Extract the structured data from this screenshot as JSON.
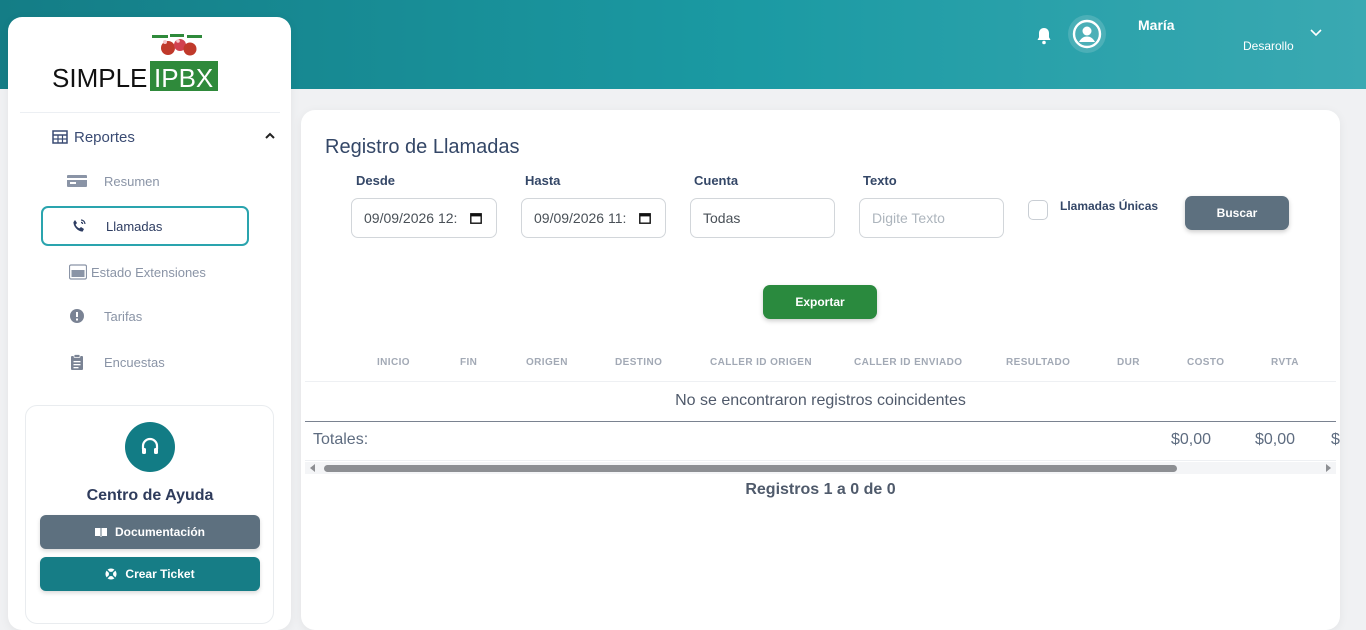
{
  "header": {
    "user_name": "María",
    "user_role": "Desarollo"
  },
  "logo": {
    "text_left": "SIMPLE",
    "text_right": "IPBX"
  },
  "sidebar": {
    "section_label": "Reportes",
    "items": [
      {
        "label": "Resumen",
        "icon": "card-icon"
      },
      {
        "label": "Llamadas",
        "icon": "phone-call-icon"
      },
      {
        "label": "Estado Extensiones",
        "icon": "monitor-icon"
      },
      {
        "label": "Tarifas",
        "icon": "alert-circle-icon"
      },
      {
        "label": "Encuestas",
        "icon": "clipboard-icon"
      }
    ]
  },
  "help": {
    "title": "Centro de Ayuda",
    "doc_label": "Documentación",
    "ticket_label": "Crear Ticket"
  },
  "main": {
    "title": "Registro de Llamadas",
    "filters": {
      "desde_label": "Desde",
      "desde_value": "09/09/2026 12:",
      "hasta_label": "Hasta",
      "hasta_value": "09/09/2026 11:",
      "cuenta_label": "Cuenta",
      "cuenta_value": "Todas",
      "texto_label": "Texto",
      "texto_placeholder": "Digite Texto",
      "unique_label": "Llamadas Únicas",
      "search_label": "Buscar"
    },
    "export_label": "Exportar",
    "table": {
      "columns": [
        "INICIO",
        "FIN",
        "ORIGEN",
        "DESTINO",
        "CALLER ID ORIGEN",
        "CALLER ID ENVIADO",
        "RESULTADO",
        "DUR",
        "COSTO",
        "RVTA"
      ],
      "empty_message": "No se encontraron registros coincidentes",
      "totals_label": "Totales:",
      "totals": [
        "$0,00",
        "$0,00"
      ],
      "totals_cut": "$"
    },
    "pagination": "Registros 1 a 0 de 0"
  },
  "colors": {
    "accent": "#1b9aa3",
    "export": "#2a8a3e",
    "buscar": "#5d707f"
  }
}
